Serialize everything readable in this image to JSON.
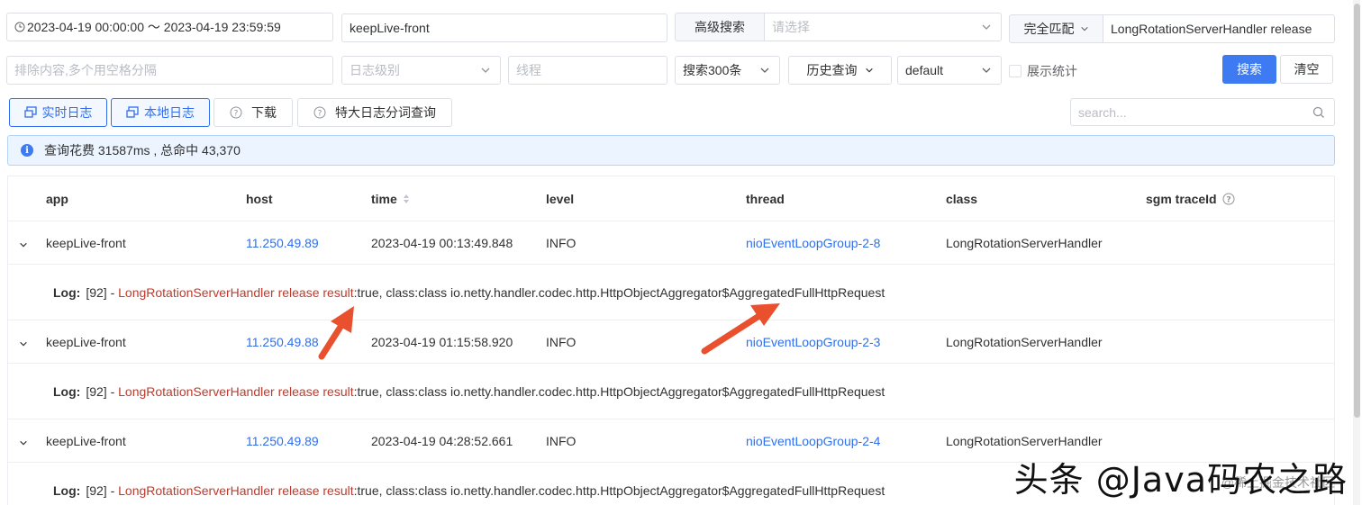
{
  "filters": {
    "date_range": "2023-04-19 00:00:00 ～ 2023-04-19 23:59:59",
    "app": "keepLive-front",
    "advanced_search_label": "高级搜索",
    "advanced_select_placeholder": "请选择",
    "match_mode": "完全匹配",
    "keyword": "LongRotationServerHandler release",
    "exclude_placeholder": "排除内容,多个用空格分隔",
    "log_level_placeholder": "日志级别",
    "thread_placeholder": "线程",
    "limit": "搜索300条",
    "history": "历史查询",
    "env": "default",
    "show_stats": "展示统计",
    "search_button": "搜索",
    "clear_button": "清空"
  },
  "toolbar": {
    "realtime_log": "实时日志",
    "local_log": "本地日志",
    "download": "下载",
    "big_log_query": "特大日志分词查询",
    "search_placeholder": "search..."
  },
  "info": {
    "message": "查询花费 31587ms , 总命中 43,370"
  },
  "table": {
    "columns": [
      "app",
      "host",
      "time",
      "level",
      "thread",
      "class",
      "sgm traceId"
    ],
    "log_label": "Log:",
    "rows": [
      {
        "app": "keepLive-front",
        "host": "11.250.49.89",
        "time": "2023-04-19 00:13:49.848",
        "level": "INFO",
        "thread": "nioEventLoopGroup-2-8",
        "class": "LongRotationServerHandler",
        "log_prefix": "[92] - ",
        "log_highlight": "LongRotationServerHandler release result",
        "log_rest": ":true, class:class io.netty.handler.codec.http.HttpObjectAggregator$AggregatedFullHttpRequest"
      },
      {
        "app": "keepLive-front",
        "host": "11.250.49.88",
        "time": "2023-04-19 01:15:58.920",
        "level": "INFO",
        "thread": "nioEventLoopGroup-2-3",
        "class": "LongRotationServerHandler",
        "log_prefix": "[92] - ",
        "log_highlight": "LongRotationServerHandler release result",
        "log_rest": ":true, class:class io.netty.handler.codec.http.HttpObjectAggregator$AggregatedFullHttpRequest"
      },
      {
        "app": "keepLive-front",
        "host": "11.250.49.89",
        "time": "2023-04-19 04:28:52.661",
        "level": "INFO",
        "thread": "nioEventLoopGroup-2-4",
        "class": "LongRotationServerHandler",
        "log_prefix": "[92] - ",
        "log_highlight": "LongRotationServerHandler release result",
        "log_rest": ":true, class:class io.netty.handler.codec.http.HttpObjectAggregator$AggregatedFullHttpRequest"
      }
    ]
  },
  "watermark": {
    "text": "头条 @Java码农之路",
    "sub": "@稀土掘金技术社区"
  },
  "colors": {
    "primary": "#3e7bf2",
    "highlight": "#c0392b",
    "arrow": "#e8502e"
  }
}
